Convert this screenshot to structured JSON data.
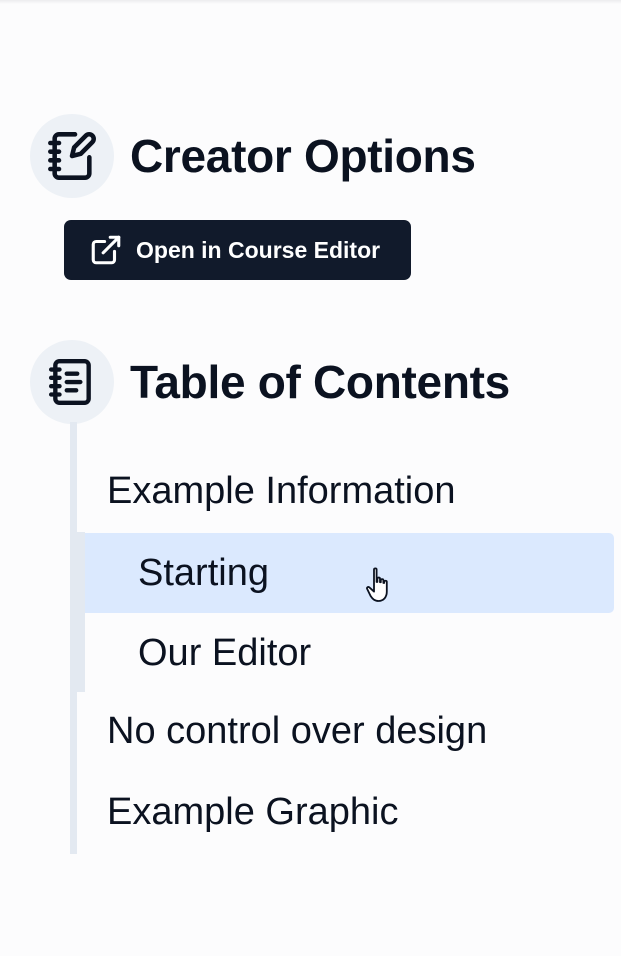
{
  "creator": {
    "title": "Creator Options",
    "icon": "notebook-pen-icon",
    "open_button_label": "Open in Course Editor",
    "open_button_icon": "external-link-icon"
  },
  "toc": {
    "title": "Table of Contents",
    "icon": "notebook-text-icon",
    "items": [
      {
        "label": "Example Information",
        "children": [
          {
            "label": "Starting",
            "active": true
          },
          {
            "label": "Our Editor",
            "active": false
          }
        ]
      },
      {
        "label": "No control over design"
      },
      {
        "label": "Example Graphic"
      }
    ]
  },
  "colors": {
    "button_bg": "#111a2b",
    "active_item_bg": "#dbe9fe",
    "rail": "#e3e9f1",
    "icon_circle": "#edf1f6"
  }
}
